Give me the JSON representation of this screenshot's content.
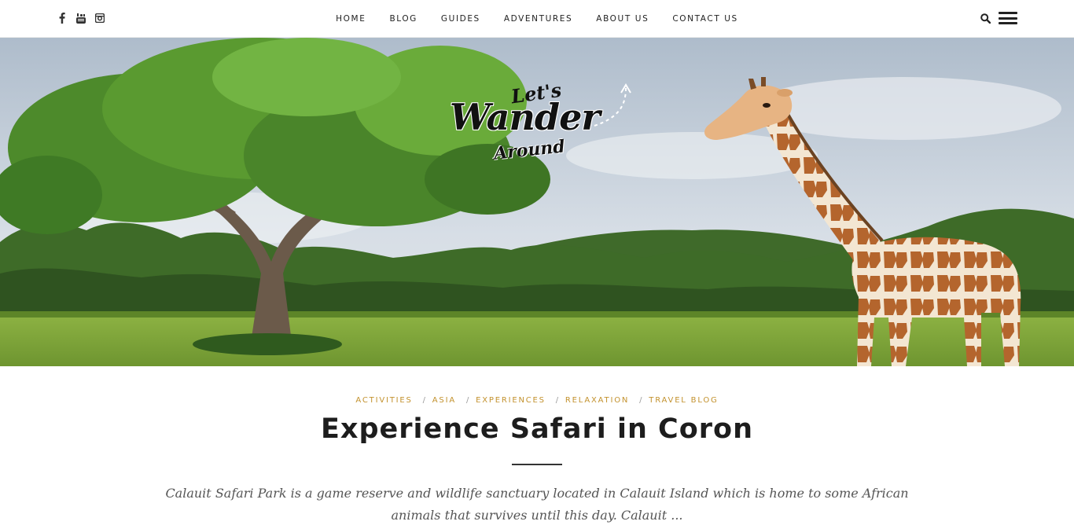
{
  "header": {
    "social": [
      {
        "icon": "facebook-icon"
      },
      {
        "icon": "youtube-icon"
      },
      {
        "icon": "instagram-icon"
      }
    ],
    "nav": [
      "HOME",
      "BLOG",
      "GUIDES",
      "ADVENTURES",
      "ABOUT US",
      "CONTACT US"
    ],
    "actions": {
      "search_icon": "search-icon",
      "menu_icon": "hamburger-menu-icon"
    }
  },
  "hero": {
    "logo": {
      "line1": "Let's",
      "line2": "Wander",
      "line3": "Around"
    }
  },
  "post": {
    "categories": [
      "ACTIVITIES",
      "ASIA",
      "EXPERIENCES",
      "RELAXATION",
      "TRAVEL BLOG"
    ],
    "separator": "/",
    "title": "Experience Safari in Coron",
    "excerpt": "Calauit Safari Park is a game reserve and wildlife sanctuary located in Calauit Island which is home to some African animals that survives until this day. Calauit ..."
  },
  "colors": {
    "category": "#c3922e",
    "title": "#1d1d1d",
    "sky": "#c9d4df",
    "grass": "#7da33a"
  }
}
